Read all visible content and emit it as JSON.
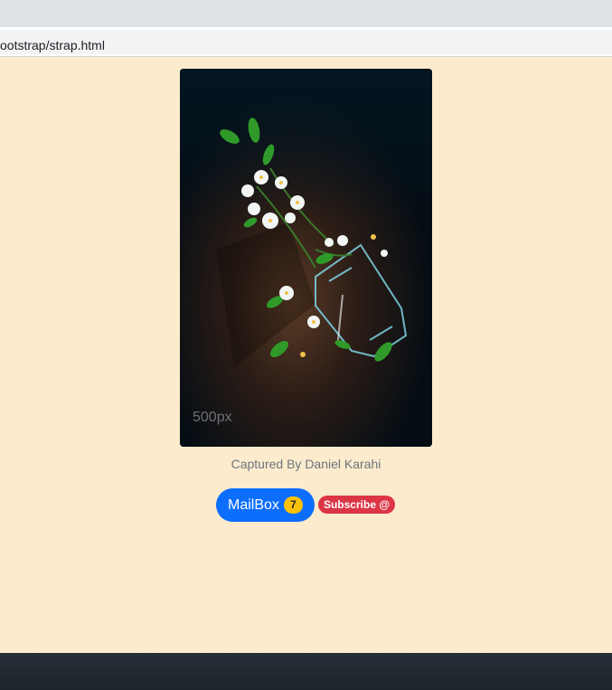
{
  "browser": {
    "url": "ootstrap/strap.html"
  },
  "figure": {
    "image_alt": "jasmine flowers spilling from a glass bottle on a dark wooden surface",
    "watermark": "500px",
    "caption": "Captured By Daniel Karahi"
  },
  "actions": {
    "mailbox_label": "MailBox",
    "mailbox_count": "7",
    "subscribe_label": "Subscribe @"
  },
  "colors": {
    "page_bg": "#fcebcd",
    "primary": "#0d6efd",
    "warning": "#ffc107",
    "danger": "#dc3545",
    "caption": "#6c757d",
    "footer": "#232b33"
  }
}
